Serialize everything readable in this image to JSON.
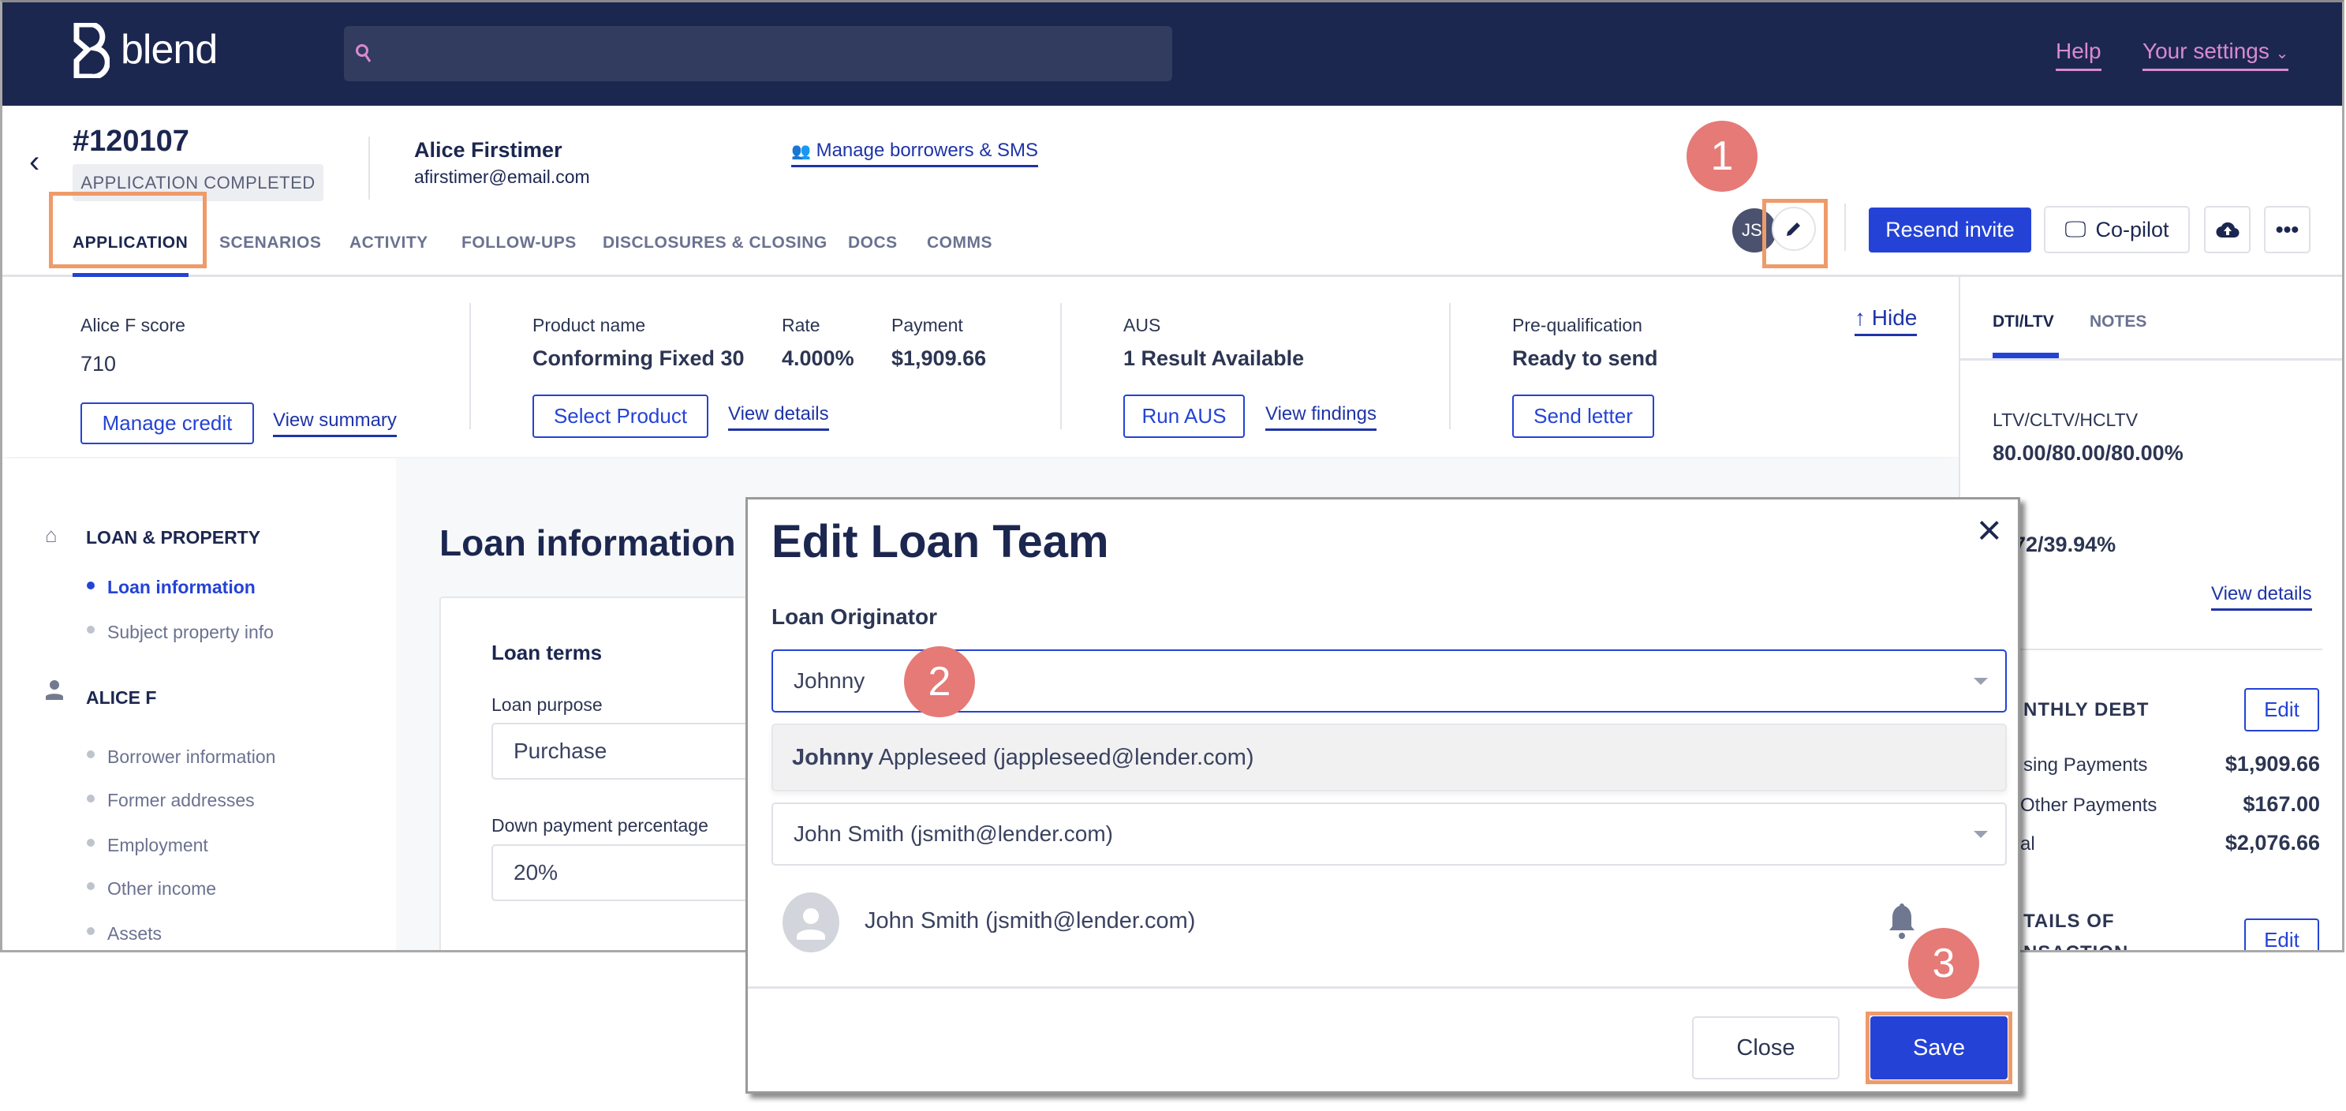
{
  "nav": {
    "brand": "blend",
    "search_placeholder": "",
    "help": "Help",
    "settings": "Your settings"
  },
  "header": {
    "loan_id": "#120107",
    "status": "APPLICATION COMPLETED",
    "borrower_name": "Alice Firstimer",
    "borrower_email": "afirstimer@email.com",
    "manage_borrowers": "Manage borrowers & SMS",
    "avatar_initials": "JS",
    "resend_invite": "Resend invite",
    "copilot": "Co-pilot"
  },
  "tabs": [
    "APPLICATION",
    "SCENARIOS",
    "ACTIVITY",
    "FOLLOW-UPS",
    "DISCLOSURES & CLOSING",
    "DOCS",
    "COMMS"
  ],
  "summary": {
    "score_label": "Alice F score",
    "score": "710",
    "manage_credit": "Manage credit",
    "view_summary": "View summary",
    "product_label": "Product name",
    "product": "Conforming Fixed 30",
    "rate_label": "Rate",
    "rate": "4.000%",
    "payment_label": "Payment",
    "payment": "$1,909.66",
    "select_product": "Select Product",
    "view_details": "View details",
    "aus_label": "AUS",
    "aus": "1 Result Available",
    "run_aus": "Run AUS",
    "view_findings": "View findings",
    "prequal_label": "Pre-qualification",
    "prequal": "Ready to send",
    "send_letter": "Send letter",
    "hide": "↑ Hide"
  },
  "sidebar": {
    "sections": [
      {
        "title": "LOAN & PROPERTY",
        "icon": "home-icon",
        "items": [
          "Loan information",
          "Subject property info"
        ]
      },
      {
        "title": "ALICE F",
        "icon": "person-icon",
        "items": [
          "Borrower information",
          "Former addresses",
          "Employment",
          "Other income",
          "Assets"
        ]
      }
    ],
    "active": "Loan information"
  },
  "main": {
    "title": "Loan information",
    "card_title": "Loan terms",
    "loan_purpose_label": "Loan purpose",
    "loan_purpose": "Purchase",
    "down_payment_label": "Down payment percentage",
    "down_payment": "20%"
  },
  "right_panel": {
    "tabs": [
      "DTI/LTV",
      "NOTES"
    ],
    "ltv_label": "LTV/CLTV/HCLTV",
    "ltv": "80.00/80.00/80.00%",
    "dti": "72/39.94%",
    "view_details": "View details",
    "debt_title": "NTHLY DEBT",
    "edit": "Edit",
    "rows": [
      {
        "label": "sing Payments",
        "value": "$1,909.66"
      },
      {
        "label": "Other Payments",
        "value": "$167.00"
      },
      {
        "label": "al",
        "value": "$2,076.66"
      }
    ],
    "details_title": "TAILS OF",
    "details_title2": "NSACTION"
  },
  "modal": {
    "title": "Edit Loan Team",
    "field_label": "Loan Originator",
    "input_value": "Johnny",
    "option_bold": "Johnny",
    "option_rest": " Appleseed (jappleseed@lender.com)",
    "second_select": "John Smith (jsmith@lender.com)",
    "member": "John Smith (jsmith@lender.com)",
    "close": "Close",
    "save": "Save"
  },
  "steps": [
    "1",
    "2",
    "3"
  ],
  "colors": {
    "navy": "#1c2750",
    "primary": "#2443d6",
    "step_badge": "#e57a77",
    "highlight": "#ee9b6a"
  }
}
